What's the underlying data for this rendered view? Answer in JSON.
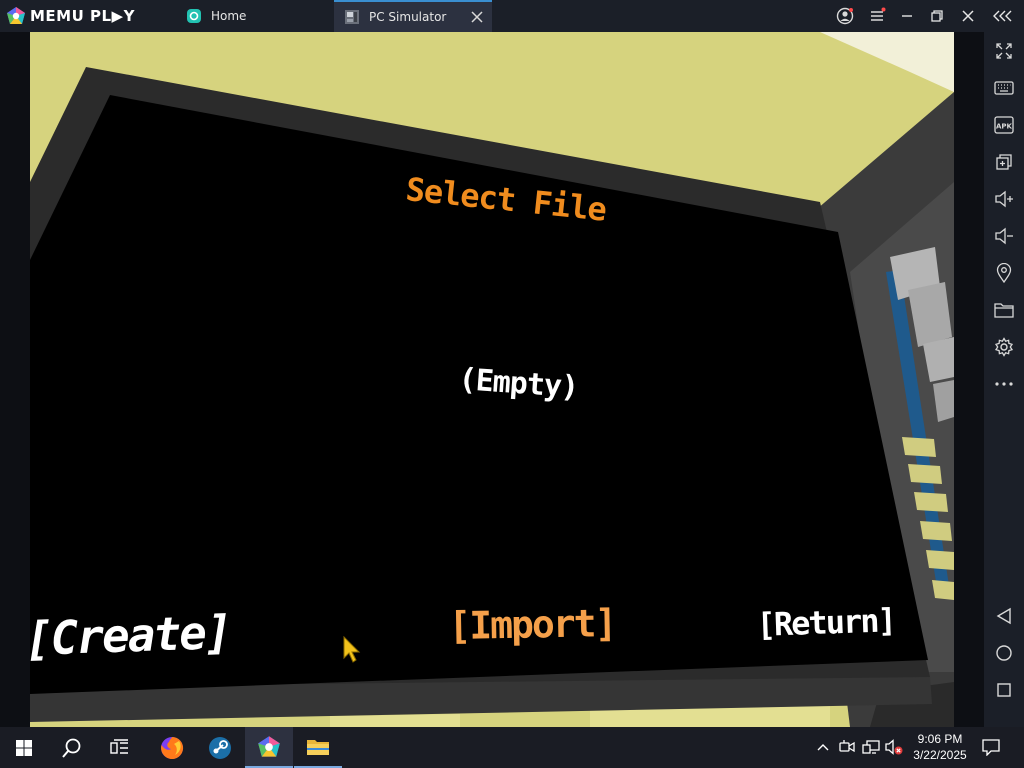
{
  "titlebar": {
    "brand": "MEMU PL▶Y",
    "tabs": [
      {
        "label": "Home",
        "active": false
      },
      {
        "label": "PC Simulator",
        "active": true
      }
    ]
  },
  "game": {
    "title": "Select File",
    "slot_label": "(Empty)",
    "buttons": {
      "create": "[Create]",
      "import": "[Import]",
      "return": "[Return]"
    }
  },
  "sidebar": {
    "icons": [
      "fullscreen-icon",
      "keyboard-icon",
      "apk-icon",
      "multi-window-icon",
      "volume-up-icon",
      "volume-down-icon",
      "location-icon",
      "folder-icon",
      "gear-icon",
      "more-icon",
      "back-icon",
      "home-circle-icon",
      "recents-square-icon"
    ],
    "apk_text": "APK"
  },
  "taskbar": {
    "time": "9:06 PM",
    "date": "3/22/2025"
  },
  "colors": {
    "title_orange": "#f08c1e",
    "import_orange": "#f5a04a",
    "ceiling_yellow": "#d6d37e",
    "accent_blue": "#3a8fd1"
  }
}
